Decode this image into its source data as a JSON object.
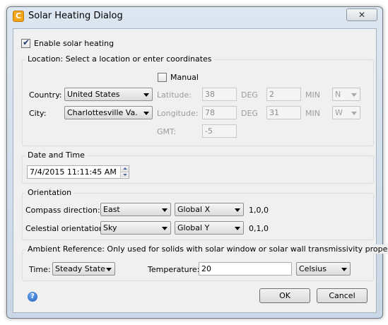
{
  "window": {
    "title": "Solar Heating Dialog",
    "close_glyph": "✕"
  },
  "enable": {
    "label": "Enable solar heating",
    "checked": true
  },
  "location": {
    "legend": "Location: Select a location or enter coordinates",
    "manual_label": "Manual",
    "country_label": "Country:",
    "country_value": "United States",
    "city_label": "City:",
    "city_value": "Charlottesville Va.",
    "latitude_label": "Latitude:",
    "latitude_deg": "38",
    "latitude_min": "2",
    "latitude_dir": "N",
    "longitude_label": "Longitude:",
    "longitude_deg": "78",
    "longitude_min": "31",
    "longitude_dir": "W",
    "deg_label": "DEG",
    "min_label": "MIN",
    "gmt_label": "GMT:",
    "gmt_value": "-5"
  },
  "datetime": {
    "legend": "Date and Time",
    "value": "7/4/2015 11:11:45 AM"
  },
  "orientation": {
    "legend": "Orientation",
    "compass_label": "Compass direction:",
    "compass_value": "East",
    "compass_axis": "Global X",
    "compass_vector": "1,0,0",
    "celestial_label": "Celestial orientation:",
    "celestial_value": "Sky",
    "celestial_axis": "Global Y",
    "celestial_vector": "0,1,0"
  },
  "ambient": {
    "legend": "Ambient Reference: Only used for solids with solar window or solar wall transmissivity properties",
    "time_label": "Time:",
    "time_value": "Steady State",
    "temperature_label": "Temperature:",
    "temperature_value": "20",
    "unit_value": "Celsius"
  },
  "footer": {
    "ok_label": "OK",
    "cancel_label": "Cancel",
    "help_glyph": "?"
  },
  "icons": {
    "app_glyph": "C",
    "check_glyph": "✔"
  }
}
